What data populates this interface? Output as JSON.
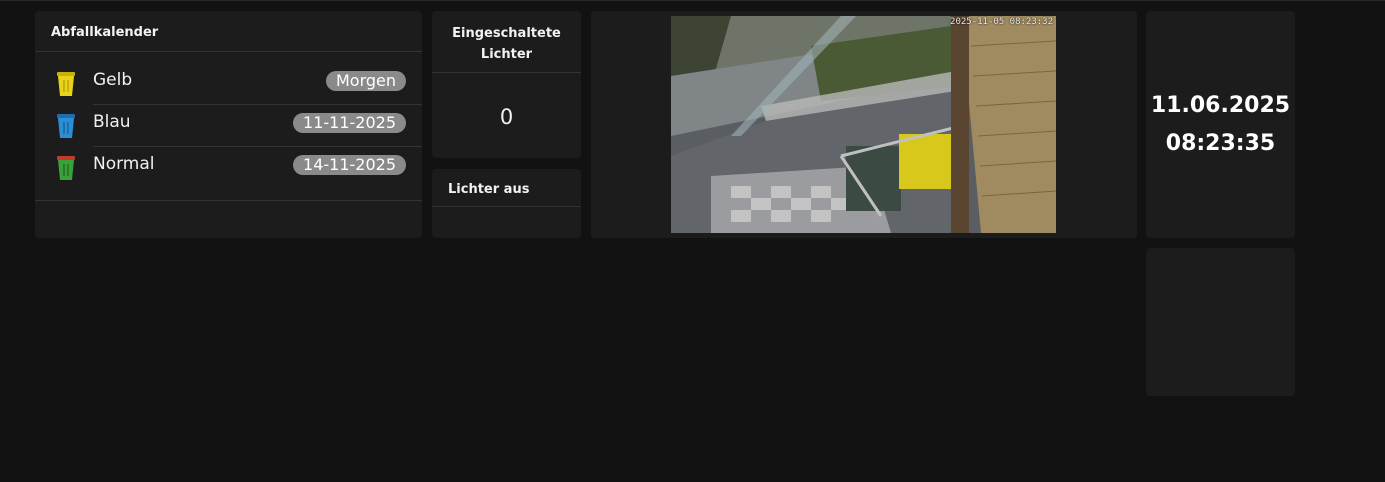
{
  "waste_calendar": {
    "title": "Abfallkalender",
    "items": [
      {
        "name": "Gelb",
        "date": "Morgen",
        "icon": "yellow-bin-icon",
        "color": "#e8d21a"
      },
      {
        "name": "Blau",
        "date": "11-11-2025",
        "icon": "blue-bin-icon",
        "color": "#2b8fd8"
      },
      {
        "name": "Normal",
        "date": "14-11-2025",
        "icon": "green-bin-icon",
        "color": "#3aa03a"
      }
    ]
  },
  "lights_on": {
    "title": "Eingeschaltete Lichter",
    "count": "0"
  },
  "lights_off": {
    "title": "Lichter aus"
  },
  "camera": {
    "timestamp": "2025-11-05 08:23:32"
  },
  "clock": {
    "date": "11.06.2025",
    "time": "08:23:35"
  }
}
